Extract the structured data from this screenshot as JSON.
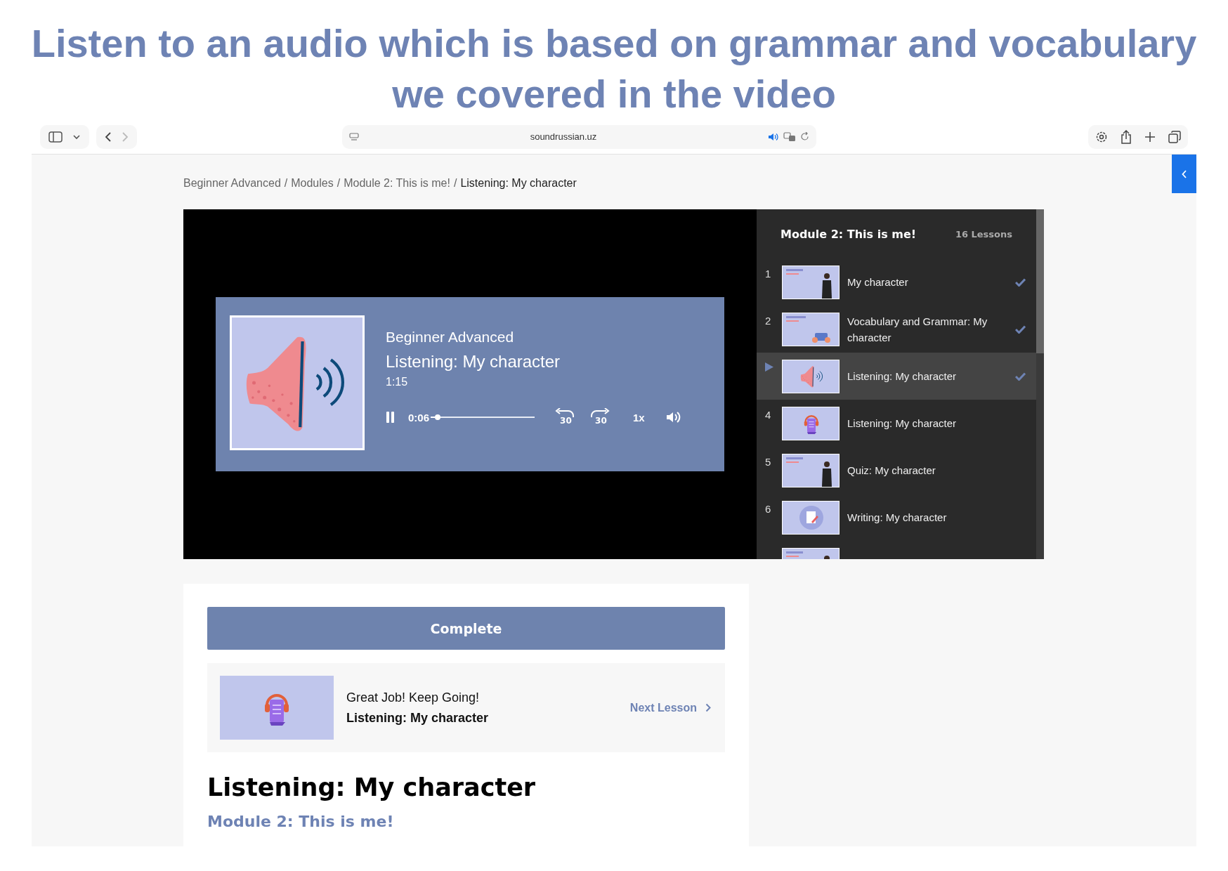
{
  "heading": "Listen to an audio which is based on grammar and vocabulary we covered in the video",
  "browser": {
    "url": "soundrussian.uz"
  },
  "breadcrumb": [
    {
      "label": "Beginner Advanced",
      "separator": "/",
      "current": false
    },
    {
      "label": "Modules",
      "separator": "/",
      "current": false
    },
    {
      "label": "Module 2: This is me!",
      "separator": "/",
      "current": false
    },
    {
      "label": "Listening: My character",
      "current": true
    }
  ],
  "player": {
    "course": "Beginner Advanced",
    "title": "Listening: My character",
    "duration": "1:15",
    "playing": true,
    "elapsed": "0:06",
    "level": 0.07,
    "rewind": "30",
    "forward": "30",
    "speed": "1x"
  },
  "sidebar": {
    "title": "Module 2: This is me!",
    "count": "16 Lessons",
    "lessons": [
      {
        "number": "1",
        "kind": "slide-person",
        "title": "My character",
        "completed": true,
        "selected": false
      },
      {
        "number": "2",
        "kind": "slide-hands",
        "title": "Vocabulary and Grammar: My character",
        "completed": true,
        "selected": false
      },
      {
        "kind": "speaker",
        "title": "Listening: My character",
        "completed": true,
        "selected": true
      },
      {
        "number": "4",
        "kind": "headphones",
        "title": "Listening: My character",
        "completed": false,
        "selected": false
      },
      {
        "number": "5",
        "kind": "slide-person",
        "title": "Quiz: My character",
        "completed": false,
        "selected": false
      },
      {
        "number": "6",
        "kind": "writing",
        "title": "Writing: My character",
        "completed": false,
        "selected": false
      },
      {
        "kind": "slide-person",
        "completed": false,
        "selected": false
      }
    ]
  },
  "complete_button": "Complete",
  "next": {
    "kind": "headphones",
    "message": "Great Job! Keep Going!",
    "lesson": "Listening: My character",
    "link": "Next Lesson"
  },
  "lesson_title": "Listening: My character",
  "module_link": "Module 2: This is me!"
}
